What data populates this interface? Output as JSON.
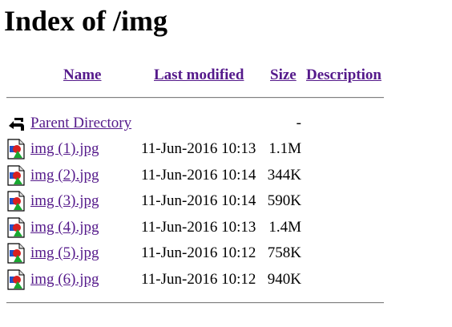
{
  "page": {
    "title": "Index of /img"
  },
  "header": {
    "name": "Name",
    "last_modified": "Last modified",
    "size": "Size",
    "description": "Description"
  },
  "parent": {
    "label": "Parent Directory",
    "size": "-",
    "icon": "back-arrow-icon"
  },
  "files": [
    {
      "name": "img (1).jpg",
      "modified": "11-Jun-2016 10:13",
      "size": "1.1M",
      "icon": "image-file-icon"
    },
    {
      "name": "img (2).jpg",
      "modified": "11-Jun-2016 10:14",
      "size": "344K",
      "icon": "image-file-icon"
    },
    {
      "name": "img (3).jpg",
      "modified": "11-Jun-2016 10:14",
      "size": "590K",
      "icon": "image-file-icon"
    },
    {
      "name": "img (4).jpg",
      "modified": "11-Jun-2016 10:13",
      "size": "1.4M",
      "icon": "image-file-icon"
    },
    {
      "name": "img (5).jpg",
      "modified": "11-Jun-2016 10:12",
      "size": "758K",
      "icon": "image-file-icon"
    },
    {
      "name": "img (6).jpg",
      "modified": "11-Jun-2016 10:12",
      "size": "940K",
      "icon": "image-file-icon"
    }
  ],
  "colors": {
    "link": "#551a8b",
    "rule": "#808080"
  }
}
